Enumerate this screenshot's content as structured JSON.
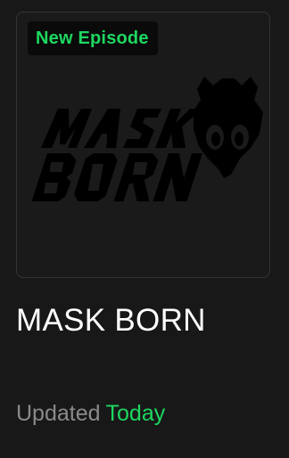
{
  "card": {
    "badge_text": "New Episode",
    "cover_logo": "mask-born-logo",
    "cover_logo_text": "MASK BORN",
    "title": "MASK BORN",
    "updated_label": "Updated",
    "updated_value": "Today"
  },
  "colors": {
    "accent": "#1ed760",
    "text_primary": "#ffffff",
    "text_muted": "#8a8a8a",
    "background": "#181818",
    "badge_bg": "#0a0a0a",
    "logo": "#000000"
  }
}
